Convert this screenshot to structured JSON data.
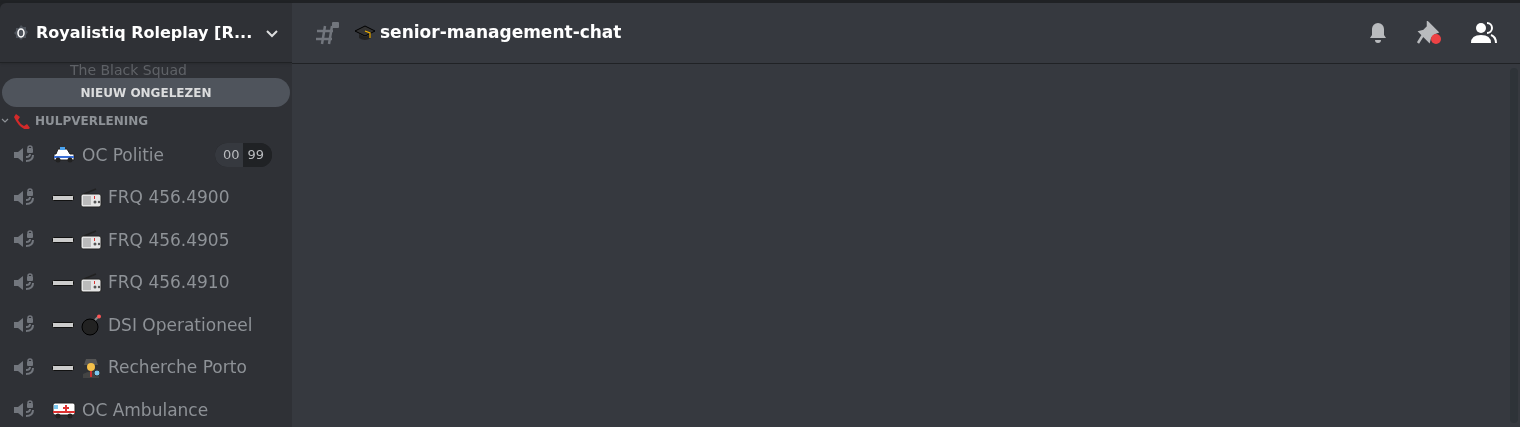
{
  "server": {
    "name": "Royalistiq Roleplay [R..."
  },
  "peek_channel": {
    "name": "The Black Squad"
  },
  "new_unread": "NIEUW ONGELEZEN",
  "category": {
    "name": "HULPVERLENING",
    "expanded": true
  },
  "channels": [
    {
      "name": "OC Politie",
      "kind": "car",
      "dash": false,
      "user_count": "00",
      "user_limit": "99"
    },
    {
      "name": "FRQ 456.4900",
      "kind": "radio",
      "dash": true
    },
    {
      "name": "FRQ 456.4905",
      "kind": "radio",
      "dash": true
    },
    {
      "name": "FRQ 456.4910",
      "kind": "radio",
      "dash": true
    },
    {
      "name": "DSI Operationeel",
      "kind": "bomb",
      "dash": true
    },
    {
      "name": "Recherche Porto",
      "kind": "detective",
      "dash": true
    },
    {
      "name": "OC Ambulance",
      "kind": "ambulance",
      "dash": false
    }
  ],
  "header": {
    "channel": "senior-management-chat",
    "unread_pins": true
  }
}
